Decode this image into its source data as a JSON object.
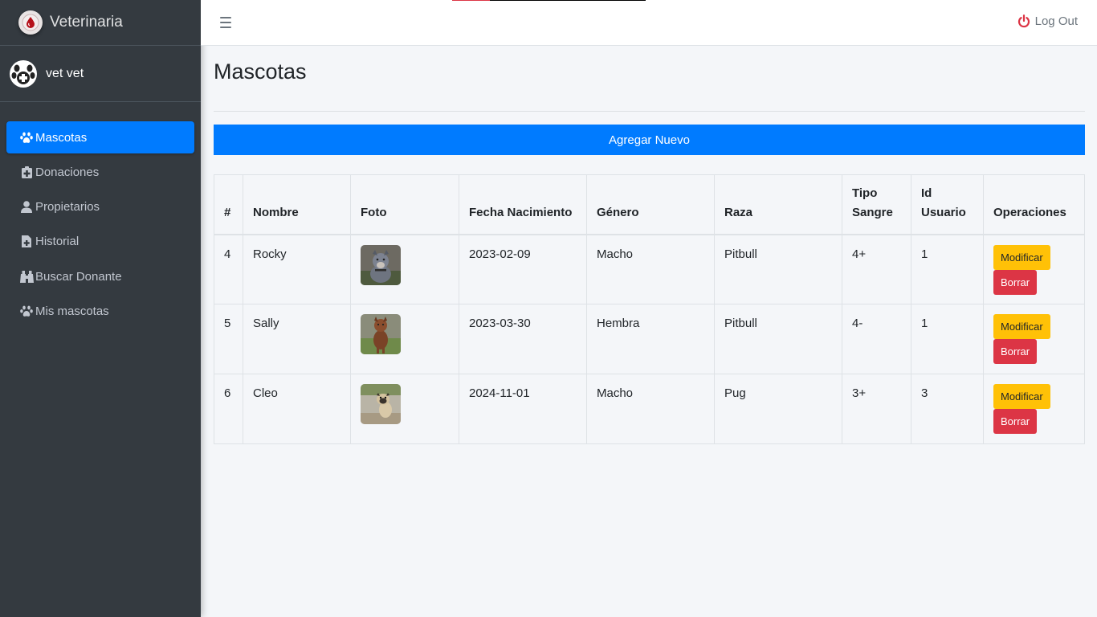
{
  "sidebar": {
    "brand_title": "Veterinaria",
    "user_name": "vet vet",
    "items": [
      {
        "label": "Mascotas",
        "icon": "paw-icon",
        "active": true
      },
      {
        "label": "Donaciones",
        "icon": "medkit-icon",
        "active": false
      },
      {
        "label": "Propietarios",
        "icon": "user-icon",
        "active": false
      },
      {
        "label": "Historial",
        "icon": "file-medical-icon",
        "active": false
      },
      {
        "label": "Buscar Donante",
        "icon": "binoculars-icon",
        "active": false
      },
      {
        "label": "Mis mascotas",
        "icon": "paw-icon",
        "active": false
      }
    ]
  },
  "topbar": {
    "logout_label": "Log Out"
  },
  "main": {
    "title": "Mascotas",
    "add_button_label": "Agregar Nuevo",
    "table": {
      "headers": {
        "id": "#",
        "nombre": "Nombre",
        "foto": "Foto",
        "fecha": "Fecha Nacimiento",
        "genero": "Género",
        "raza": "Raza",
        "tipo_line1": "Tipo",
        "tipo_line2": "Sangre",
        "usuario_line1": "Id",
        "usuario_line2": "Usuario",
        "operaciones": "Operaciones"
      },
      "rows": [
        {
          "id": "4",
          "nombre": "Rocky",
          "fecha": "2023-02-09",
          "genero": "Macho",
          "raza": "Pitbull",
          "tipo": "4+",
          "usuario": "1"
        },
        {
          "id": "5",
          "nombre": "Sally",
          "fecha": "2023-03-30",
          "genero": "Hembra",
          "raza": "Pitbull",
          "tipo": "4-",
          "usuario": "1"
        },
        {
          "id": "6",
          "nombre": "Cleo",
          "fecha": "2024-11-01",
          "genero": "Macho",
          "raza": "Pug",
          "tipo": "3+",
          "usuario": "3"
        }
      ],
      "modify_label": "Modificar",
      "delete_label": "Borrar"
    }
  },
  "colors": {
    "primary": "#007bff",
    "warning": "#ffc107",
    "danger": "#dc3545",
    "sidebar_bg": "#343a40"
  }
}
